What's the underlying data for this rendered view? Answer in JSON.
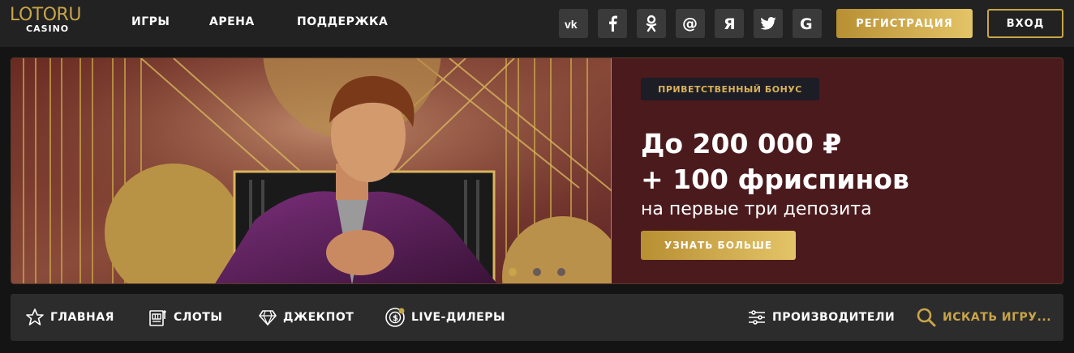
{
  "header": {
    "logo_top": "LOTORU",
    "logo_bottom": "CASINO",
    "nav": [
      "ИГРЫ",
      "АРЕНА",
      "ПОДДЕРЖКА"
    ],
    "social": [
      {
        "icon": "vk-icon",
        "glyph": "vk"
      },
      {
        "icon": "facebook-icon",
        "glyph": "f"
      },
      {
        "icon": "odnoklassniki-icon",
        "glyph": "ok"
      },
      {
        "icon": "mail-icon",
        "glyph": "@"
      },
      {
        "icon": "yandex-icon",
        "glyph": "Я"
      },
      {
        "icon": "twitter-icon",
        "glyph": "tw"
      },
      {
        "icon": "google-icon",
        "glyph": "G"
      }
    ],
    "register_label": "РЕГИСТРАЦИЯ",
    "login_label": "ВХОД"
  },
  "banner": {
    "badge": "ПРИВЕТСТВЕННЫЙ БОНУС",
    "line1": "До 200 000 ₽",
    "line2": "+ 100 фриспинов",
    "line3": "на первые три депозита",
    "cta": "УЗНАТЬ БОЛЬШЕ",
    "slides_total": 3,
    "slide_active": 1
  },
  "categories": {
    "items": [
      {
        "label": "ГЛАВНАЯ",
        "icon": "star-icon"
      },
      {
        "label": "СЛОТЫ",
        "icon": "slot-machine-icon"
      },
      {
        "label": "ДЖЕКПОТ",
        "icon": "diamond-icon"
      },
      {
        "label": "LIVE-ДИЛЕРЫ",
        "icon": "chip-icon"
      }
    ],
    "providers_label": "ПРОИЗВОДИТЕЛИ",
    "search_label": "ИСКАТЬ ИГРУ..."
  },
  "colors": {
    "accent": "#c9a54a",
    "topbar": "#222222",
    "banner": "#4b1a1d",
    "catbar": "#2c2c2c"
  }
}
